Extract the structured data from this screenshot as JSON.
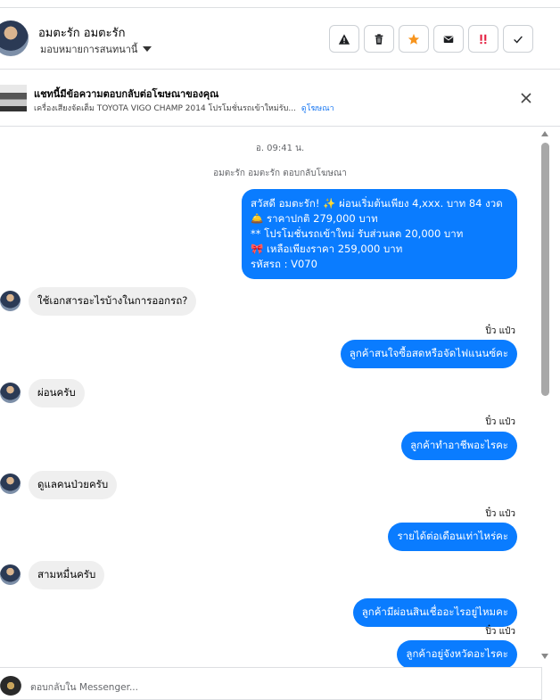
{
  "header": {
    "contact_name": "อมตะรัก อมตะรัก",
    "assign_label": "มอบหมายการสนทนานี้",
    "actions": [
      {
        "name": "warning-button",
        "icon": "warning-icon"
      },
      {
        "name": "delete-button",
        "icon": "trash-icon"
      },
      {
        "name": "star-button",
        "icon": "star-icon"
      },
      {
        "name": "mail-button",
        "icon": "envelope-icon"
      },
      {
        "name": "priority-button",
        "icon": "exclamation-icon"
      },
      {
        "name": "done-button",
        "icon": "check-icon"
      }
    ]
  },
  "ad": {
    "title": "แชทนี้มีข้อความตอบกลับต่อโฆษณาของคุณ",
    "subtitle": "เครื่องเสียงจัดเต็ม TOYOTA VIGO CHAMP 2014 โปรโมชั่นรถเข้าใหม่รับ...",
    "link": "ดูโฆษณา"
  },
  "thread": {
    "timestamp": "อ. 09:41 น.",
    "reply_note": "อมตะรัก อมตะรัก ตอบกลับโฆษณา",
    "first_message_lines": [
      "สวัสดี อมตะรัก! ✨ ผ่อนเริ่มต้นเพียง 4,xxx. บาท 84 งวด",
      "🛎️ ราคาปกติ 279,000 บาท",
      "** โปรโมชั่นรถเข้าใหม่ รับส่วนลด 20,000 บาท",
      "🎀 เหลือเพียงราคา 259,000 บาท",
      " รหัสรถ : V070"
    ],
    "incoming": [
      "ใช้เอกสารอะไรบ้างในการออกรถ?",
      "ผ่อนครับ",
      "ดูแลคนป่วยครับ",
      "สามหมื่นครับ"
    ],
    "sender_name": "ปิ๋ว แป๋ว",
    "outgoing": [
      "ลูกค้าสนใจซื้อสดหรือจัดไฟแนนซ์คะ",
      "ลูกค้าทำอาชีพอะไรคะ",
      "รายได้ต่อเดือนเท่าไหร่คะ",
      "ลูกค้ามีผ่อนสินเชื่ออะไรอยู่ไหมคะ",
      "ลูกค้าอยู่จังหวัดอะไรคะ"
    ]
  },
  "composer": {
    "placeholder": "ตอบกลับใน Messenger..."
  },
  "colors": {
    "outgoing_bubble": "#0a7cff",
    "incoming_bubble": "#efefef",
    "link": "#1877f2",
    "star": "#f7941d",
    "priority": "#e41e3f"
  }
}
